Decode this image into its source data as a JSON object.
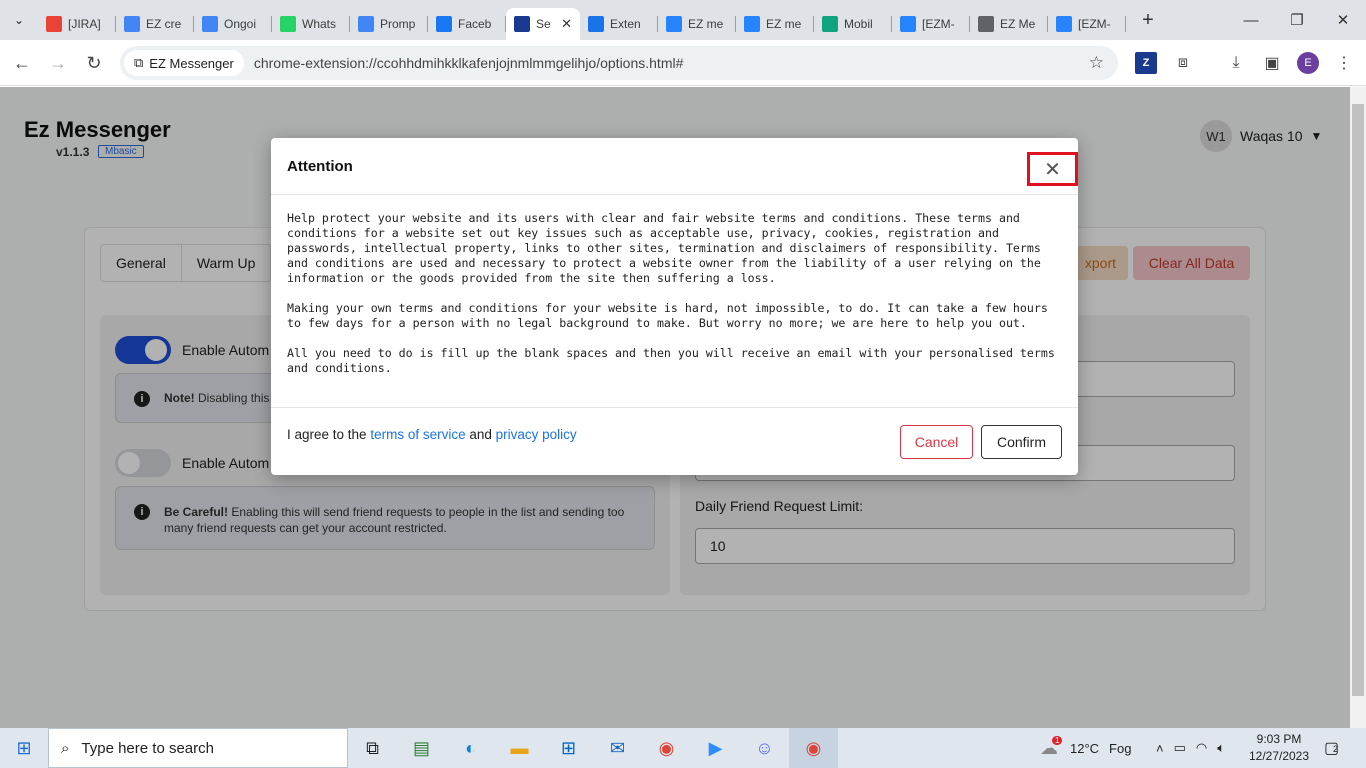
{
  "browser": {
    "tabs": [
      {
        "title": "[JIRA]",
        "icon": "gmail-icon",
        "color": "#ea4335"
      },
      {
        "title": "EZ cre",
        "icon": "docs-icon",
        "color": "#4285f4"
      },
      {
        "title": "Ongoi",
        "icon": "docs-icon",
        "color": "#4285f4"
      },
      {
        "title": "Whats",
        "icon": "whatsapp-icon",
        "color": "#25d366"
      },
      {
        "title": "Promp",
        "icon": "docs-icon",
        "color": "#4285f4"
      },
      {
        "title": "Faceb",
        "icon": "facebook-icon",
        "color": "#1877f2"
      },
      {
        "title": "Se",
        "icon": "ez-icon",
        "color": "#1a3a8f",
        "active": true
      },
      {
        "title": "Exten",
        "icon": "puzzle-icon",
        "color": "#1a73e8"
      },
      {
        "title": "EZ me",
        "icon": "jira-icon",
        "color": "#2684ff"
      },
      {
        "title": "EZ me",
        "icon": "jira-icon",
        "color": "#2684ff"
      },
      {
        "title": "Mobil",
        "icon": "chatgpt-icon",
        "color": "#10a37f"
      },
      {
        "title": "[EZM-",
        "icon": "jira-icon",
        "color": "#2684ff"
      },
      {
        "title": "EZ Me",
        "icon": "globe-icon",
        "color": "#5f6368"
      },
      {
        "title": "[EZM-",
        "icon": "jira-icon",
        "color": "#2684ff"
      }
    ],
    "chip_label": "EZ Messenger",
    "url": "chrome-extension://ccohhdmihkklkafenjojnmlmmgelihjo/options.html#",
    "profile_initial": "E"
  },
  "app": {
    "title": "Ez Messenger",
    "version": "v1.1.3",
    "mode_badge": "Mbasic",
    "user_initials": "W1",
    "user_name": "Waqas 10",
    "tabs": [
      "General",
      "Warm Up"
    ],
    "export_label": "xport",
    "clear_label": "Clear All Data",
    "toggle1_label": "Enable Autom",
    "note1_bold": "Note!",
    "note1_text": " Disabling this",
    "toggle2_label": "Enable Autom",
    "note2_bold": "Be Careful!",
    "note2_text": " Enabling this will send friend requests to people in the list and sending too many friend requests can get your account restricted.",
    "limit_label": "Daily Friend Request Limit:",
    "limit_value": "10"
  },
  "modal": {
    "title": "Attention",
    "close_glyph": "✕",
    "paragraphs": [
      "Help protect your website and its users with clear and fair website terms and conditions. These terms and conditions for a website set out key issues such as acceptable use, privacy, cookies, registration and passwords, intellectual property, links to other sites, termination and disclaimers of responsibility. Terms and conditions are used and necessary to protect a website owner from the liability of a user relying on the information or the goods provided from the site then suffering a loss.",
      "Making your own terms and conditions for your website is hard, not impossible, to do. It can take a few hours to few days for a person with no legal background to make. But worry no more; we are here to help you out.",
      "All you need to do is fill up the blank spaces and then you will receive an email with your personalised terms and conditions."
    ],
    "agree_prefix": "I agree to the ",
    "terms_link": "terms of service",
    "agree_and": " and ",
    "privacy_link": "privacy policy",
    "cancel_label": "Cancel",
    "confirm_label": "Confirm"
  },
  "taskbar": {
    "search_placeholder": "Type here to search",
    "weather_temp": "12°C",
    "weather_desc": "Fog",
    "weather_badge": "1",
    "time": "9:03 PM",
    "date": "12/27/2023",
    "notif_count": "2"
  },
  "colors": {
    "accent": "#1a73e8",
    "toggle_on": "#1d4ed8",
    "danger": "#dc3545",
    "highlight_box": "#e0101f"
  }
}
